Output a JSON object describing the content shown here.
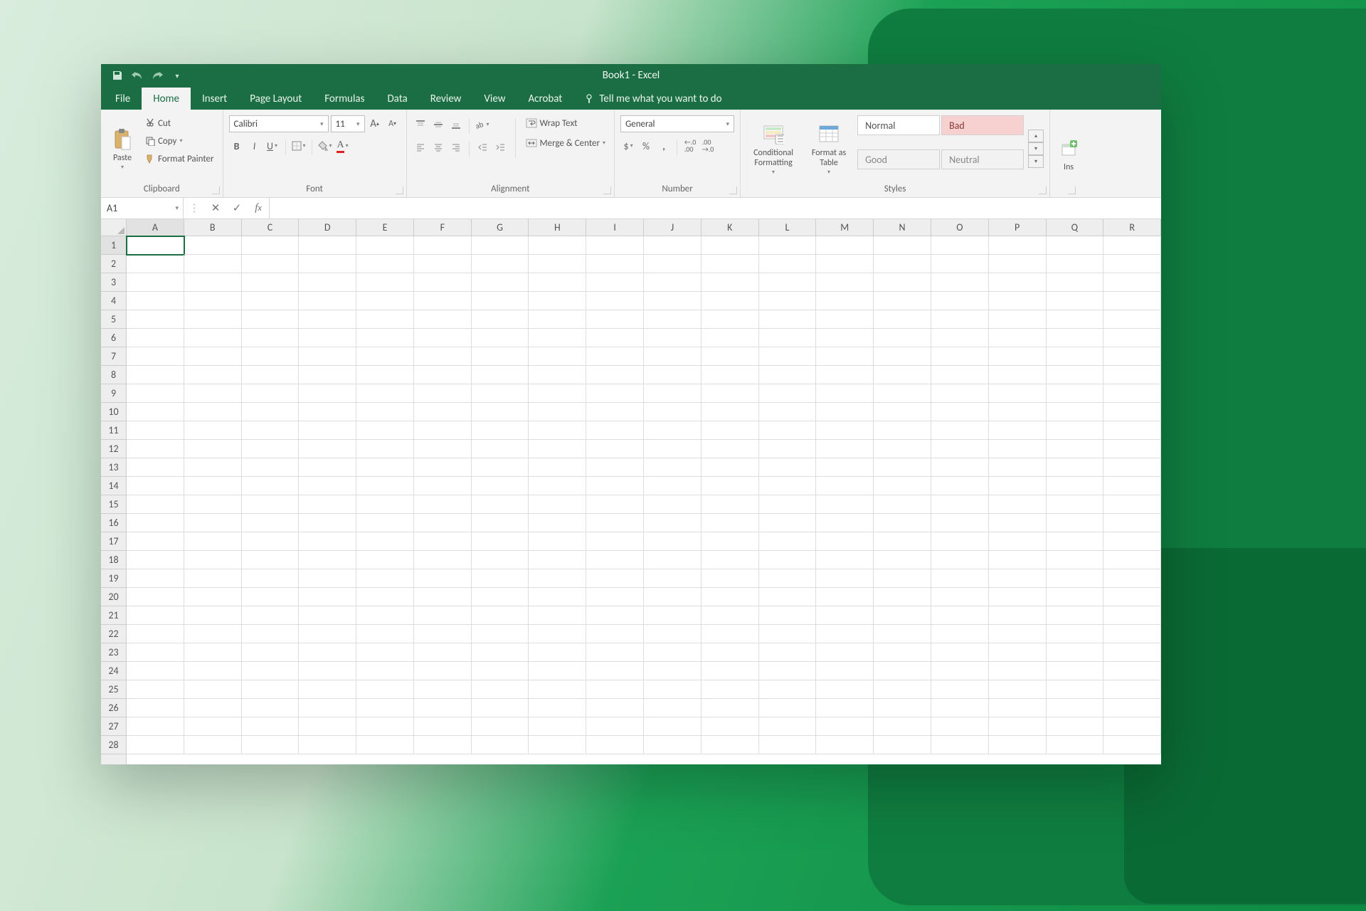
{
  "title": "Book1 - Excel",
  "tabs": [
    "File",
    "Home",
    "Insert",
    "Page Layout",
    "Formulas",
    "Data",
    "Review",
    "View",
    "Acrobat"
  ],
  "activeTab": "Home",
  "tellme": "Tell me what you want to do",
  "clipboard": {
    "paste": "Paste",
    "cut": "Cut",
    "copy": "Copy",
    "formatPainter": "Format Painter",
    "title": "Clipboard"
  },
  "font": {
    "name": "Calibri",
    "size": "11",
    "title": "Font"
  },
  "alignment": {
    "wrap": "Wrap Text",
    "merge": "Merge & Center",
    "title": "Alignment"
  },
  "number": {
    "format": "General",
    "title": "Number"
  },
  "styles": {
    "conditional": "Conditional Formatting",
    "formatTable": "Format as Table",
    "normal": "Normal",
    "bad": "Bad",
    "good": "Good",
    "neutral": "Neutral",
    "title": "Styles"
  },
  "cells": {
    "insert": "Ins"
  },
  "namebox": "A1",
  "columns": [
    "A",
    "B",
    "C",
    "D",
    "E",
    "F",
    "G",
    "H",
    "I",
    "J",
    "K",
    "L",
    "M",
    "N",
    "O",
    "P",
    "Q",
    "R"
  ],
  "rows": 28,
  "activeCell": {
    "col": 0,
    "row": 0
  }
}
